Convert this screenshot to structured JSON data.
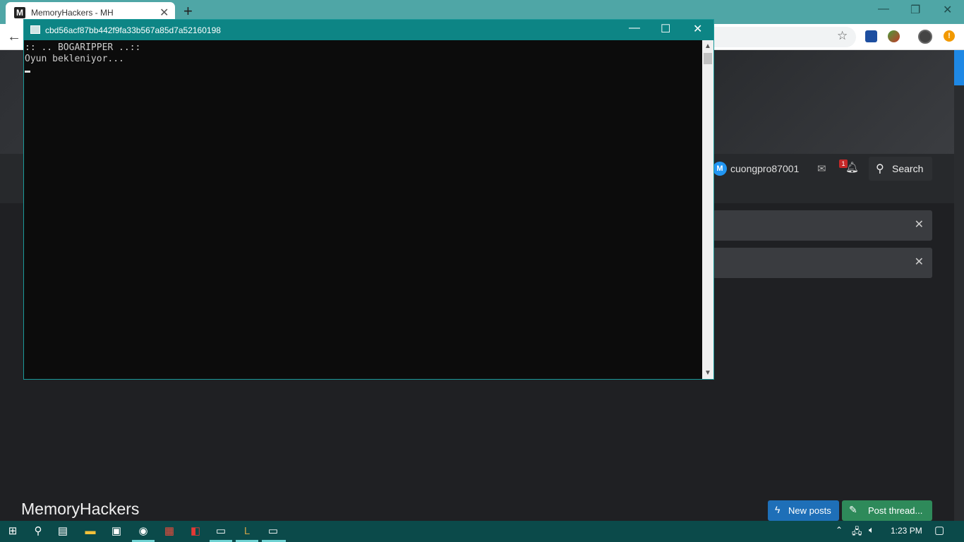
{
  "browser": {
    "tab_title": "MemoryHackers - MH",
    "tab_close": "✕",
    "new_tab": "+",
    "favicon_letter": "M"
  },
  "site": {
    "user": {
      "avatar_letter": "M",
      "name": "cuongpro87001"
    },
    "notifications_count": "1",
    "search_label": "Search",
    "notice_close": "✕",
    "title": "MemoryHackers",
    "new_posts_label": "New posts",
    "post_thread_label": "Post thread..."
  },
  "console": {
    "title": "cbd56acf87bb442f9fa33b567a85d7a52160198",
    "lines": [
      ":: .. BOGARIPPER ..::",
      "Oyun bekleniyor..."
    ]
  },
  "taskbar": {
    "clock": "1:23 PM"
  },
  "colors": {
    "console_titlebar": "#0d8585",
    "tabstrip": "#4fa6a6",
    "new_posts": "#1e6fb8",
    "post_thread": "#2e8a5a",
    "taskbar": "#0b4a4a"
  }
}
